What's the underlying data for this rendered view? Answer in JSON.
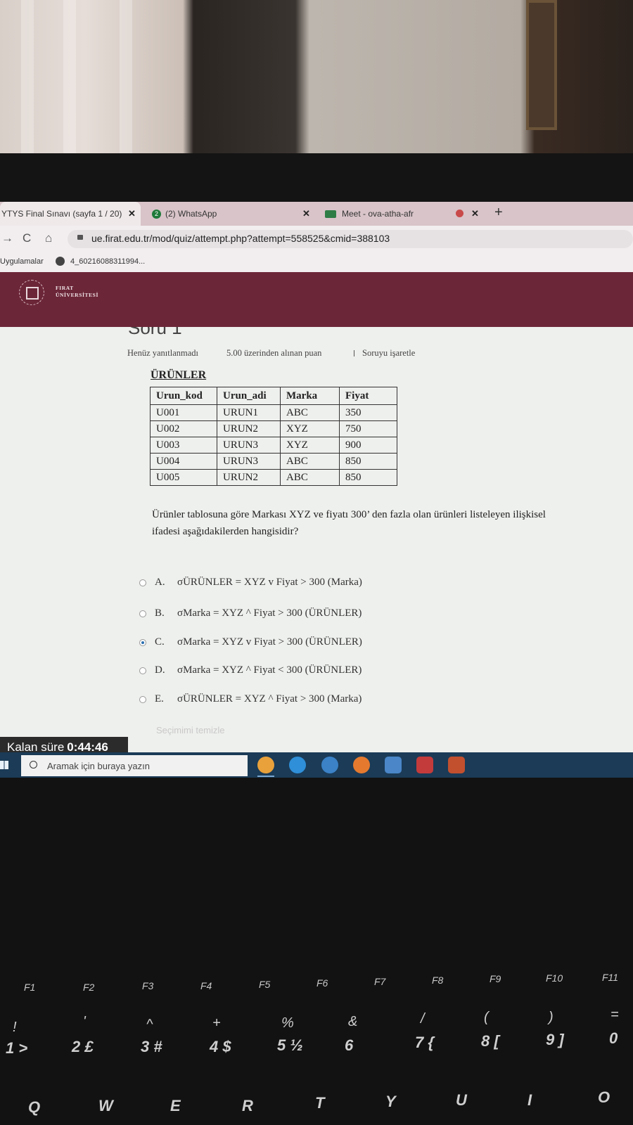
{
  "browser": {
    "tabs": [
      {
        "label": "YTYS Final Sınavı (sayfa 1 / 20)"
      },
      {
        "label": "(2) WhatsApp",
        "badge": "2"
      },
      {
        "label": "Meet - ova-atha-afr"
      }
    ],
    "url": "ue.firat.edu.tr/mod/quiz/attempt.php?attempt=558525&cmid=388103",
    "bookmarks": [
      "Uygulamalar",
      "4_60216088311994..."
    ]
  },
  "site": {
    "logo_line1": "FIRAT",
    "logo_line2": "ÜNİVERSİTESİ"
  },
  "question": {
    "title": "Soru 1",
    "status": "Henüz yanıtlanmadı",
    "points": "5.00 üzerinden alınan puan",
    "flag": "Soruyu işaretle",
    "table_title": "ÜRÜNLER",
    "table_headers": [
      "Urun_kod",
      "Urun_adi",
      "Marka",
      "Fiyat"
    ],
    "table_rows": [
      [
        "U001",
        "URUN1",
        "ABC",
        "350"
      ],
      [
        "U002",
        "URUN2",
        "XYZ",
        "750"
      ],
      [
        "U003",
        "URUN3",
        "XYZ",
        "900"
      ],
      [
        "U004",
        "URUN3",
        "ABC",
        "850"
      ],
      [
        "U005",
        "URUN2",
        "ABC",
        "850"
      ]
    ],
    "text_line1": "Ürünler tablosuna göre Markası XYZ ve fiyatı 300’ den fazla olan ürünleri listeleyen ilişkisel",
    "text_line2": "ifadesi aşağıdakilerden hangisidir?",
    "options": [
      {
        "letter": "A.",
        "text": "σÜRÜNLER = XYZ v Fiyat > 300 (Marka)",
        "selected": false
      },
      {
        "letter": "B.",
        "text": "σMarka = XYZ ^ Fiyat > 300 (ÜRÜNLER)",
        "selected": false
      },
      {
        "letter": "C.",
        "text": "σMarka = XYZ v Fiyat > 300 (ÜRÜNLER)",
        "selected": true
      },
      {
        "letter": "D.",
        "text": "σMarka = XYZ ^ Fiyat < 300 (ÜRÜNLER)",
        "selected": false
      },
      {
        "letter": "E.",
        "text": "σÜRÜNLER = XYZ ^ Fiyat > 300 (Marka)",
        "selected": false
      }
    ],
    "clear_choice": "Seçimimi temizle"
  },
  "timer": {
    "label": "Kalan süre",
    "value": "0:44:46"
  },
  "taskbar": {
    "search_placeholder": "Aramak için buraya yazın"
  },
  "keyboard": {
    "fkeys": [
      "F1",
      "F2",
      "F3",
      "F4",
      "F5",
      "F6",
      "F7",
      "F8",
      "F9",
      "F10",
      "F11"
    ],
    "number_row": [
      "1 >",
      "2 £",
      "3 #",
      "4 $",
      "5 ½",
      "6",
      "7 {",
      "8 [",
      "9 ]",
      "0"
    ],
    "symbol_row": [
      "!",
      "'",
      "^",
      "+",
      "%",
      "&",
      "/",
      "(",
      ")",
      "="
    ],
    "letter_row": [
      "Q",
      "W",
      "E",
      "R",
      "T",
      "Y",
      "U",
      "I",
      "O"
    ]
  }
}
